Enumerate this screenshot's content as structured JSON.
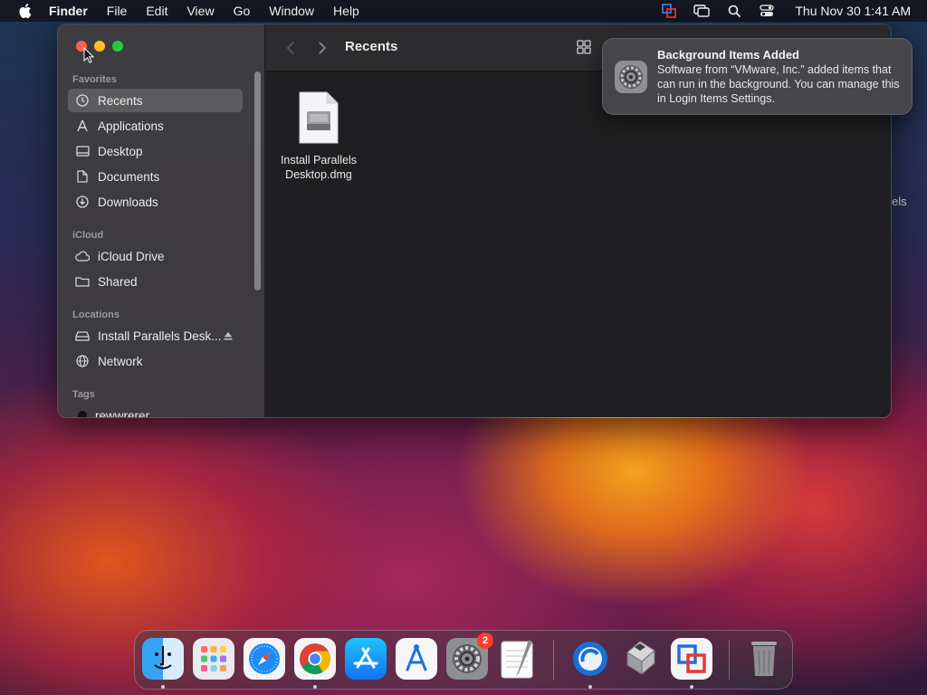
{
  "menubar": {
    "app_name": "Finder",
    "items": [
      "File",
      "Edit",
      "View",
      "Go",
      "Window",
      "Help"
    ],
    "clock": "Thu Nov 30  1:41 AM",
    "status_icons": [
      "parallels-icon",
      "screen-mirroring-icon",
      "spotlight-icon",
      "control-center-icon"
    ]
  },
  "finder": {
    "title": "Recents",
    "sections": {
      "favorites": "Favorites",
      "icloud": "iCloud",
      "locations": "Locations",
      "tags": "Tags"
    },
    "favorites": [
      "Recents",
      "Applications",
      "Desktop",
      "Documents",
      "Downloads"
    ],
    "icloud": [
      "iCloud Drive",
      "Shared"
    ],
    "locations": [
      "Install Parallels Desk...",
      "Network"
    ],
    "tags": [
      "rewwrerer"
    ],
    "files": [
      {
        "name_line1": "Install Parallels",
        "name_line2": "Desktop.dmg"
      }
    ]
  },
  "peek_text": "els",
  "notification": {
    "title": "Background Items Added",
    "body": "Software from “VMware, Inc.” added items that can run in the background. You can manage this in Login Items Settings."
  },
  "dock": {
    "apps": [
      "Finder",
      "Launchpad",
      "Safari",
      "Google Chrome",
      "App Store",
      "Instruments",
      "System Settings",
      "TextEdit",
      "Parallels Desktop",
      "Boot Camp Assistant",
      "Parallels",
      "Trash"
    ],
    "system_settings_badge": "2"
  },
  "colors": {
    "accent_red": "#ff5f57",
    "accent_yellow": "#febc2e",
    "accent_green": "#28c840",
    "badge_red": "#ff3b30"
  }
}
